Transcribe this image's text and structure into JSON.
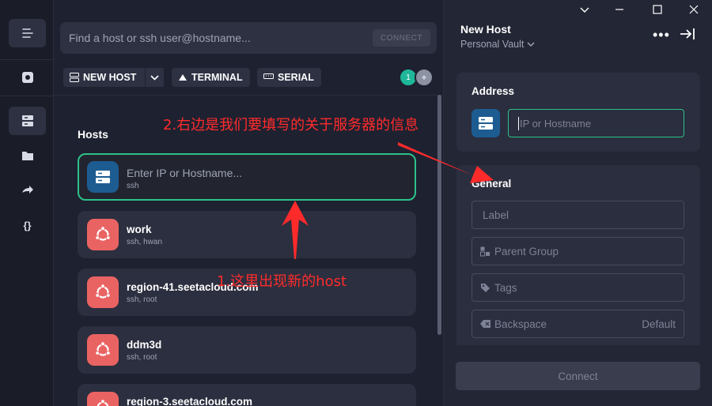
{
  "search": {
    "placeholder": "Find a host or ssh user@hostname...",
    "connect_chip": "CONNECT"
  },
  "toolbar": {
    "new_host": "NEW HOST",
    "terminal": "TERMINAL",
    "serial": "SERIAL"
  },
  "avatars": {
    "count_badge": "1",
    "add_badge": "+"
  },
  "hosts": {
    "title": "Hosts",
    "new_host_card": {
      "placeholder": "Enter IP or Hostname...",
      "subtitle": "ssh"
    },
    "items": [
      {
        "name": "work",
        "detail": "ssh, hwan",
        "icon": "ubuntu-icon"
      },
      {
        "name": "region-41.seetacloud.com",
        "detail": "ssh, root",
        "icon": "ubuntu-icon"
      },
      {
        "name": "ddm3d",
        "detail": "ssh, root",
        "icon": "ubuntu-icon"
      },
      {
        "name": "region-3.seetacloud.com",
        "detail": "",
        "icon": "ubuntu-icon"
      }
    ]
  },
  "panel": {
    "title": "New Host",
    "vault": "Personal Vault",
    "address": {
      "title": "Address",
      "placeholder": "IP or Hostname"
    },
    "general": {
      "title": "General",
      "label_placeholder": "Label",
      "parent_group_placeholder": "Parent Group",
      "tags_placeholder": "Tags",
      "backspace_label": "Backspace",
      "backspace_value": "Default"
    },
    "connect": "Connect"
  },
  "annotations": {
    "right_side": "2.右边是我们要填写的关于服务器的信息",
    "new_host": "1.这里出现新的host"
  },
  "colors": {
    "accent_green": "#2cc28a",
    "ubuntu": "#ea6363",
    "server_blue": "#1d5c91",
    "annotation_red": "#ff2b2b"
  }
}
